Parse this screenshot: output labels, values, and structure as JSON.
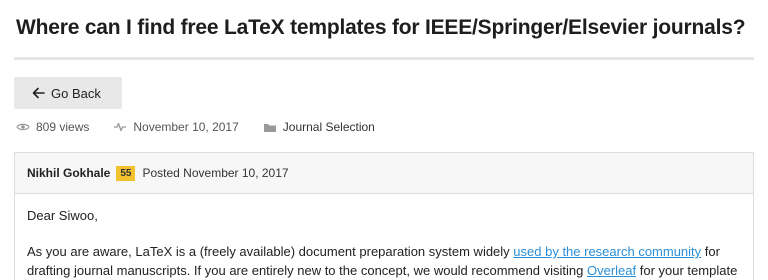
{
  "question": {
    "title": "Where can I find free LaTeX templates for IEEE/Springer/Elsevier journals?"
  },
  "nav": {
    "back_label": "Go Back"
  },
  "meta": {
    "views": "809 views",
    "date": "November 10, 2017",
    "category": "Journal Selection"
  },
  "post": {
    "author": "Nikhil Gokhale",
    "reputation": "55",
    "posted": "Posted November 10, 2017",
    "greeting": "Dear Siwoo,",
    "para1_part1": "As you are aware, LaTeX is a (freely available) document preparation system widely ",
    "para1_link1": "used by the research community",
    "para1_part2": " for",
    "para2_part1": "drafting journal manuscripts. If you are entirely new to the concept, we would recommend visiting ",
    "para2_link": "Overleaf",
    "para2_part2": " for your template"
  },
  "colors": {
    "link": "#2a8fd6",
    "badge": "#f2c12e",
    "button_bg": "#e8e8e8",
    "divider": "#e6e6e6"
  },
  "icons": {
    "back": "arrow-left-icon",
    "views": "eye-icon",
    "date": "activity-icon",
    "category": "folder-icon"
  }
}
